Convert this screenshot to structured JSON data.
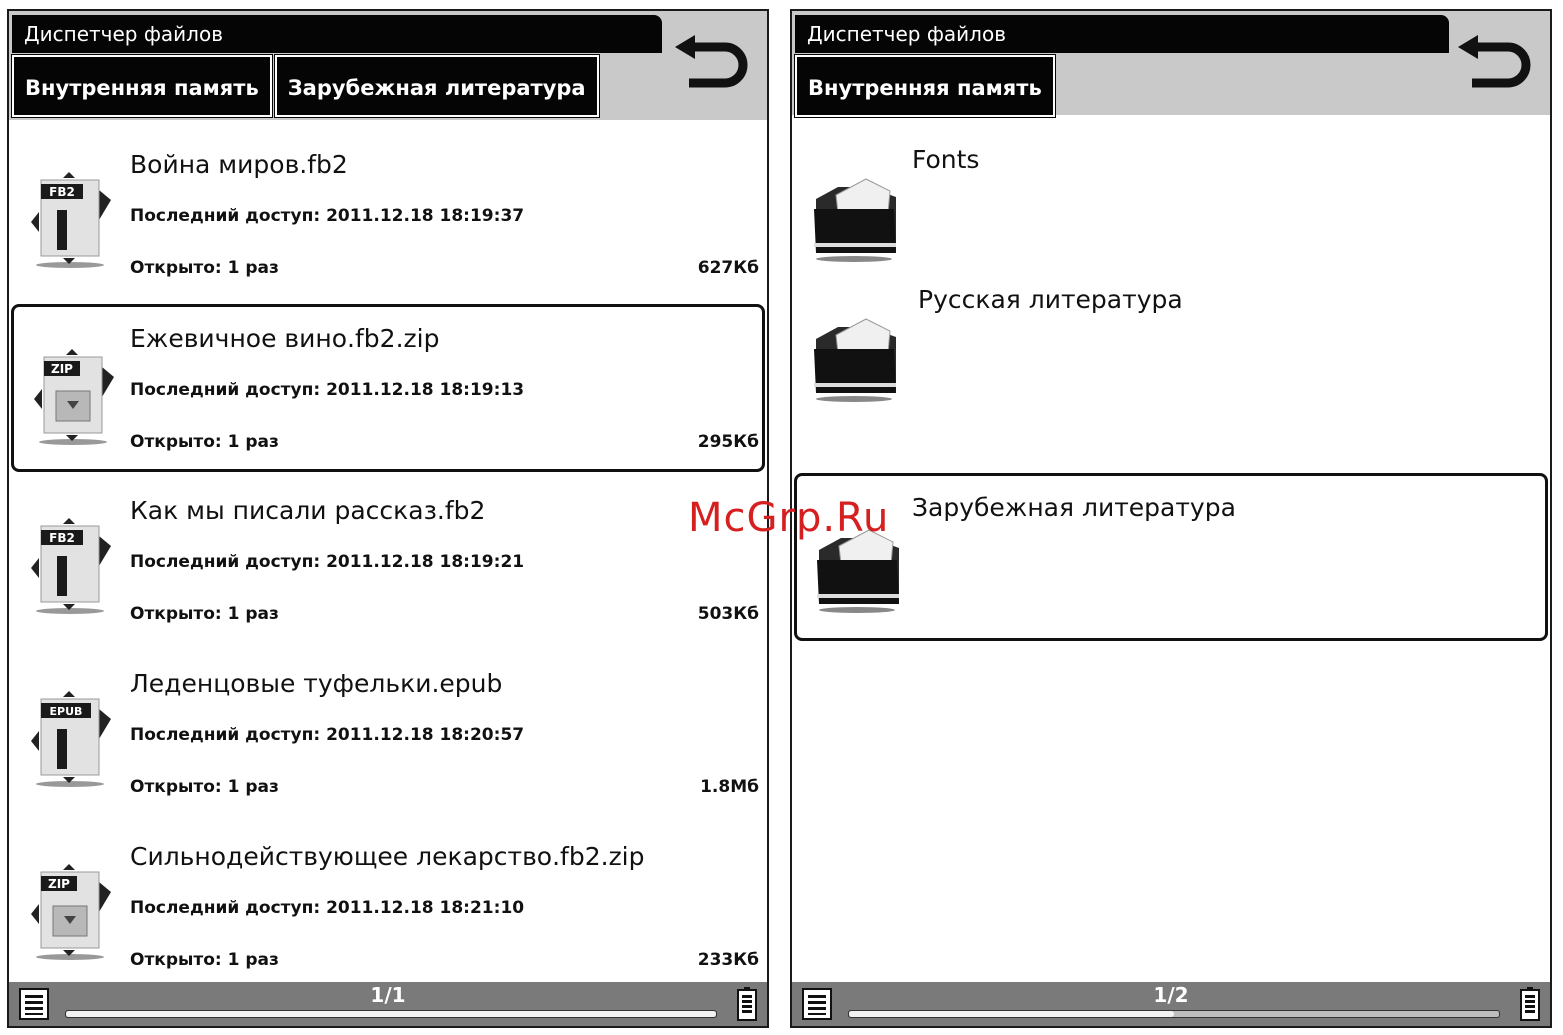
{
  "left": {
    "title": "Диспетчер файлов",
    "breadcrumbs": [
      "Внутренняя память",
      "Зарубежная литература"
    ],
    "files": [
      {
        "icon": "fb2-file-icon",
        "icon_label": "FB2",
        "name": "Война миров.fb2",
        "last_access": "Последний доступ: 2011.12.18 18:19:37",
        "opened": "Открыто: 1 раз",
        "size": "627Кб",
        "selected": false
      },
      {
        "icon": "zip-file-icon",
        "icon_label": "ZIP",
        "name": "Ежевичное вино.fb2.zip",
        "last_access": "Последний доступ: 2011.12.18 18:19:13",
        "opened": "Открыто: 1 раз",
        "size": "295Кб",
        "selected": true
      },
      {
        "icon": "fb2-file-icon",
        "icon_label": "FB2",
        "name": "Как мы писали рассказ.fb2",
        "last_access": "Последний доступ: 2011.12.18 18:19:21",
        "opened": "Открыто: 1 раз",
        "size": "503Кб",
        "selected": false
      },
      {
        "icon": "epub-file-icon",
        "icon_label": "EPUB",
        "name": "Леденцовые туфельки.epub",
        "last_access": "Последний доступ: 2011.12.18 18:20:57",
        "opened": "Открыто: 1 раз",
        "size": "1.8Мб",
        "selected": false
      },
      {
        "icon": "zip-file-icon",
        "icon_label": "ZIP",
        "name": "Сильнодействующее лекарство.fb2.zip",
        "last_access": "Последний доступ: 2011.12.18 18:21:10",
        "opened": "Открыто: 1 раз",
        "size": "233Кб",
        "selected": false
      }
    ],
    "page": "1/1",
    "page_progress": 1.0
  },
  "right": {
    "title": "Диспетчер файлов",
    "breadcrumbs": [
      "Внутренняя память"
    ],
    "folders": [
      {
        "icon": "folder-icon",
        "name": "Fonts",
        "selected": false
      },
      {
        "icon": "folder-icon",
        "name": "Русская литература",
        "selected": false
      },
      {
        "icon": "folder-icon",
        "name": "Зарубежная литература",
        "selected": true
      }
    ],
    "page": "1/2",
    "page_progress": 0.5
  },
  "watermark": "McGrp.Ru",
  "colors": {
    "bar": "#050505",
    "header_bg": "#c9c9c9",
    "status_bg": "#7a7a7a",
    "watermark": "#d62020"
  }
}
